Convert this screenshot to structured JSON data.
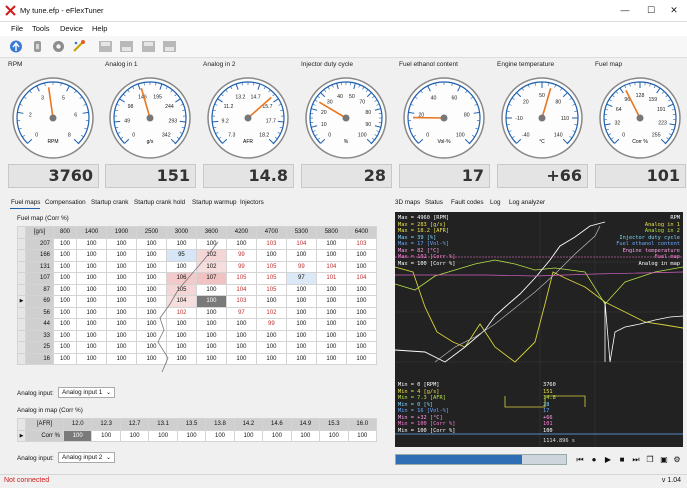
{
  "window": {
    "title": "My tune.efp - eFlexTuner",
    "minimize": "—",
    "maximize": "☐",
    "close": "✕"
  },
  "menu": [
    "File",
    "Tools",
    "Device",
    "Help"
  ],
  "toolbar_icons": [
    "connect-icon",
    "disconnect-icon",
    "settings-icon",
    "wizard-icon",
    "save-icon",
    "load-icon",
    "export-icon",
    "import-icon"
  ],
  "gauges": [
    {
      "label": "RPM",
      "unit": "RPM",
      "ticks": [
        "0",
        "2",
        "3",
        "5",
        "6",
        "8"
      ],
      "value_text": "3760",
      "fraction": 0.47
    },
    {
      "label": "Analog in 1",
      "unit": "g/s",
      "ticks": [
        "0",
        "49",
        "98",
        "146",
        "195",
        "244",
        "293",
        "342"
      ],
      "tick_labels_shown": [
        "0",
        "49",
        "98",
        "146",
        "195",
        "244",
        "293",
        "342"
      ],
      "value_text": "151",
      "fraction": 0.44
    },
    {
      "label": "Analog in 2",
      "unit": "AFR",
      "ticks": [
        "7.3",
        "9.2",
        "11.2",
        "13.2",
        "14.7",
        "15.7",
        "17.7",
        "18.2"
      ],
      "value_text": "14.8",
      "fraction": 0.68
    },
    {
      "label": "Injector duty cycle",
      "unit": "%",
      "ticks": [
        "0",
        "10",
        "20",
        "30",
        "40",
        "50",
        "70",
        "80",
        "90",
        "100"
      ],
      "value_text": "28",
      "fraction": 0.28
    },
    {
      "label": "Fuel ethanol content",
      "unit": "Vol-%",
      "ticks": [
        "0",
        "20",
        "40",
        "60",
        "80",
        "100"
      ],
      "value_text": "17",
      "fraction": 0.17
    },
    {
      "label": "Engine temperature",
      "unit": "°C",
      "ticks": [
        "-40",
        "-10",
        "20",
        "50",
        "80",
        "110",
        "140"
      ],
      "value_text": "+66",
      "fraction": 0.56
    },
    {
      "label": "Fuel map",
      "unit": "Corr %",
      "ticks": [
        "0",
        "32",
        "64",
        "96",
        "128",
        "159",
        "191",
        "223",
        "255"
      ],
      "value_text": "101",
      "fraction": 0.4
    }
  ],
  "left_tabs": [
    "Fuel maps",
    "Compensation",
    "Startup crank",
    "Startup crank hold",
    "Startup warmup",
    "Injectors"
  ],
  "right_tabs": [
    "3D maps",
    "Status",
    "Fault codes",
    "Log",
    "Log analyzer"
  ],
  "fuel_map": {
    "title": "Fuel map (Corr %)",
    "corner": "[g/s]",
    "cols": [
      "800",
      "1400",
      "1900",
      "2500",
      "3000",
      "3600",
      "4200",
      "4700",
      "5300",
      "5800",
      "6400"
    ],
    "rows": [
      {
        "load": "207",
        "cells": [
          "100",
          "100",
          "100",
          "100",
          "100",
          "100",
          "100",
          "103",
          "104",
          "100",
          "103"
        ]
      },
      {
        "load": "166",
        "cells": [
          "100",
          "100",
          "100",
          "100",
          "95",
          "102",
          "99",
          "100",
          "100",
          "100",
          "100"
        ]
      },
      {
        "load": "131",
        "cells": [
          "100",
          "100",
          "100",
          "100",
          "100",
          "102",
          "99",
          "105",
          "99",
          "104",
          "100"
        ]
      },
      {
        "load": "107",
        "cells": [
          "100",
          "100",
          "100",
          "100",
          "106",
          "107",
          "105",
          "105",
          "97",
          "101",
          "104"
        ]
      },
      {
        "load": "87",
        "cells": [
          "100",
          "100",
          "100",
          "100",
          "105",
          "100",
          "104",
          "105",
          "100",
          "100",
          "100"
        ]
      },
      {
        "load": "69",
        "cells": [
          "100",
          "100",
          "100",
          "100",
          "104",
          "100",
          "103",
          "100",
          "100",
          "100",
          "100"
        ]
      },
      {
        "load": "56",
        "cells": [
          "100",
          "100",
          "100",
          "100",
          "102",
          "100",
          "97",
          "102",
          "100",
          "100",
          "100"
        ]
      },
      {
        "load": "44",
        "cells": [
          "100",
          "100",
          "100",
          "100",
          "100",
          "100",
          "100",
          "99",
          "100",
          "100",
          "100"
        ]
      },
      {
        "load": "33",
        "cells": [
          "100",
          "100",
          "100",
          "100",
          "100",
          "100",
          "100",
          "100",
          "100",
          "100",
          "100"
        ]
      },
      {
        "load": "25",
        "cells": [
          "100",
          "100",
          "100",
          "100",
          "100",
          "100",
          "100",
          "100",
          "100",
          "100",
          "100"
        ]
      },
      {
        "load": "16",
        "cells": [
          "100",
          "100",
          "100",
          "100",
          "100",
          "100",
          "100",
          "100",
          "100",
          "100",
          "100"
        ]
      }
    ],
    "selected_row_marker": "▶"
  },
  "analog_input_1": {
    "label": "Analog input:",
    "value": "Analog input 1"
  },
  "analog_map": {
    "title": "Analog in map (Corr %)",
    "corner": "[AFR]",
    "row_label": "Corr %",
    "cols": [
      "12.0",
      "12.3",
      "12.7",
      "13.1",
      "13.5",
      "13.8",
      "14.2",
      "14.6",
      "14.9",
      "15.3",
      "16.0"
    ],
    "cells": [
      "100",
      "100",
      "100",
      "100",
      "100",
      "100",
      "100",
      "100",
      "100",
      "100",
      "100"
    ]
  },
  "analog_input_2": {
    "label": "Analog input:",
    "value": "Analog input 2"
  },
  "scope": {
    "left_legend": [
      {
        "text": "Max = 4960 [RPM]",
        "color": "#ffffff"
      },
      {
        "text": "Max = 283 [g/s]",
        "color": "#e8e24a"
      },
      {
        "text": "Max = 18.2 [AFR]",
        "color": "#e8e24a"
      },
      {
        "text": "Max = 39 [%]",
        "color": "#7dd8ff"
      },
      {
        "text": "Max = 17 [Vol-%]",
        "color": "#6aa8ff"
      },
      {
        "text": "Max = 82 [°C]",
        "color": "#ff9de8"
      },
      {
        "text": "Max = 102 [Corr %]",
        "color": "#ff7ad9"
      },
      {
        "text": "Max = 100 [Corr %]",
        "color": "#ffffff"
      }
    ],
    "right_legend": [
      {
        "text": "RPM",
        "color": "#ffffff"
      },
      {
        "text": "Analog in 1",
        "color": "#e8e24a"
      },
      {
        "text": "Analog in 2",
        "color": "#b5e04a"
      },
      {
        "text": "Injector duty cycle",
        "color": "#7dd8ff"
      },
      {
        "text": "Fuel ethanol content",
        "color": "#6aa8ff"
      },
      {
        "text": "Engine temperature",
        "color": "#ff9de8"
      },
      {
        "text": "Fuel map",
        "color": "#ff7ad9"
      },
      {
        "text": "Analog in map",
        "color": "#ffffff"
      }
    ],
    "min_legend": [
      {
        "text": "Min = 0 [RPM]",
        "color": "#ffffff"
      },
      {
        "text": "Min = 4 [g/s]",
        "color": "#e8e24a"
      },
      {
        "text": "Min = 7.3 [AFR]",
        "color": "#b5e04a"
      },
      {
        "text": "Min = 0 [%]",
        "color": "#7dd8ff"
      },
      {
        "text": "Min = 16 [Vol-%]",
        "color": "#6aa8ff"
      },
      {
        "text": "Min = +32 [°C]",
        "color": "#ff9de8"
      },
      {
        "text": "Min = 100 [Corr %]",
        "color": "#ff7ad9"
      },
      {
        "text": "Min = 100 [Corr %]",
        "color": "#ffffff"
      }
    ],
    "cursor_values": [
      {
        "text": "3760",
        "color": "#ffffff"
      },
      {
        "text": "151",
        "color": "#e8e24a"
      },
      {
        "text": "14.8",
        "color": "#b5e04a"
      },
      {
        "text": "28",
        "color": "#7dd8ff"
      },
      {
        "text": "17",
        "color": "#6aa8ff"
      },
      {
        "text": "+66",
        "color": "#ff9de8"
      },
      {
        "text": "101",
        "color": "#ff7ad9"
      },
      {
        "text": "100",
        "color": "#ffffff"
      }
    ],
    "time_readout": "1114.896 s"
  },
  "playback": {
    "progress": 0.74,
    "controls": [
      "skip-back-icon",
      "record-icon",
      "play-icon",
      "stop-icon",
      "skip-forward-icon",
      "open-file-icon",
      "save-file-icon",
      "settings-icon"
    ],
    "glyphs": [
      "⏮",
      "●",
      "▶",
      "■",
      "⏭",
      "❐",
      "▣",
      "⚙"
    ]
  },
  "status": {
    "connection": "Not connected",
    "version": "v 1.04"
  },
  "colors": {
    "accent": "#e87722",
    "gauge_blue": "#1e5fae",
    "progress_blue": "#2f6db5",
    "status_red": "#d11b1b"
  }
}
